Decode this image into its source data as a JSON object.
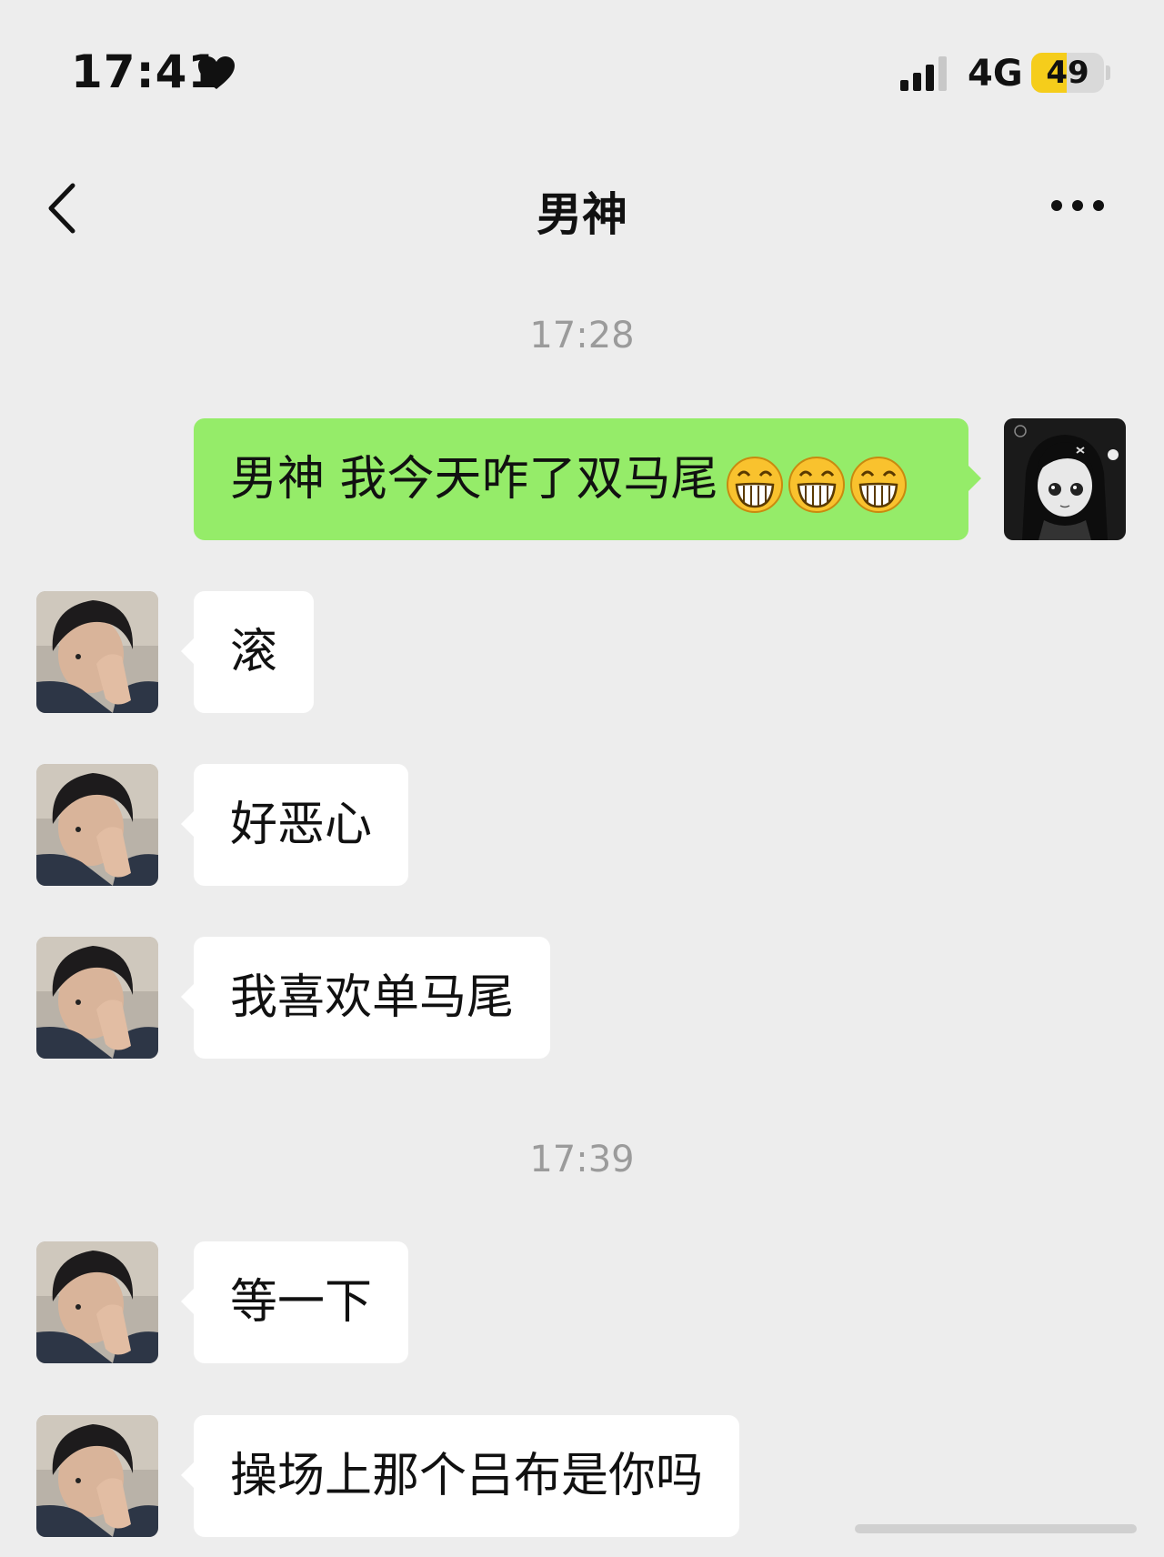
{
  "status_bar": {
    "time": "17:41",
    "network": "4G",
    "battery_level": "49",
    "battery_fraction": 0.49
  },
  "nav": {
    "title": "男神",
    "back_icon": "chevron-left-icon",
    "more_icon": "more-dots-icon"
  },
  "messages": {
    "timestamp_1": "17:28",
    "sent_1": {
      "text": "男神 我今天咋了双马尾",
      "emojis": [
        "grin-icon",
        "grin-icon",
        "grin-icon"
      ]
    },
    "received_1": "滚",
    "received_2": "好恶心",
    "received_3": "我喜欢单马尾",
    "timestamp_2": "17:39",
    "received_4": "等一下",
    "received_5": "操场上那个吕布是你吗"
  },
  "colors": {
    "background": "#ededed",
    "sent_bubble": "#95ec69",
    "received_bubble": "#ffffff",
    "battery_accent": "#f5cd1b"
  }
}
